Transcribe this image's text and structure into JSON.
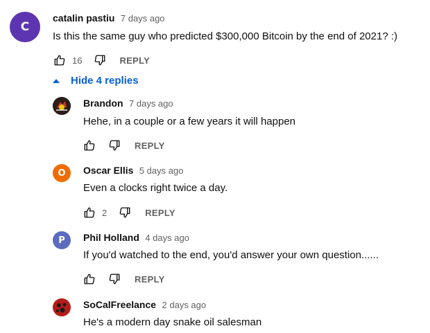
{
  "top_comment": {
    "avatar_letter": "C",
    "avatar_color": "#5e35b1",
    "author": "catalin pastiu",
    "time": "7 days ago",
    "text": "Is this the same guy who predicted $300,000 Bitcoin by the end of 2021? :)",
    "likes": "16",
    "reply_label": "REPLY"
  },
  "replies_toggle": {
    "label": "Hide 4 replies",
    "icon": "caret-up-icon"
  },
  "replies": [
    {
      "author": "Brandon",
      "time": "7 days ago",
      "text": "Hehe, in a couple or a few years it will happen",
      "likes": "",
      "reply_label": "REPLY",
      "avatar_letter": "",
      "avatar_color": "#3a2a20"
    },
    {
      "author": "Oscar Ellis",
      "time": "5 days ago",
      "text": "Even a clocks right twice a day.",
      "likes": "2",
      "reply_label": "REPLY",
      "avatar_letter": "O",
      "avatar_color": "#ef6c00"
    },
    {
      "author": "Phil Holland",
      "time": "4 days ago",
      "text": "If you'd watched to the end, you'd answer your own question......",
      "likes": "",
      "reply_label": "REPLY",
      "avatar_letter": "P",
      "avatar_color": "#5c6bc0"
    },
    {
      "author": "SoCalFreelance",
      "time": "2 days ago",
      "text": "He's a modern day snake oil salesman",
      "likes": "",
      "reply_label": "REPLY",
      "avatar_letter": "",
      "avatar_color": "#c62828"
    }
  ]
}
